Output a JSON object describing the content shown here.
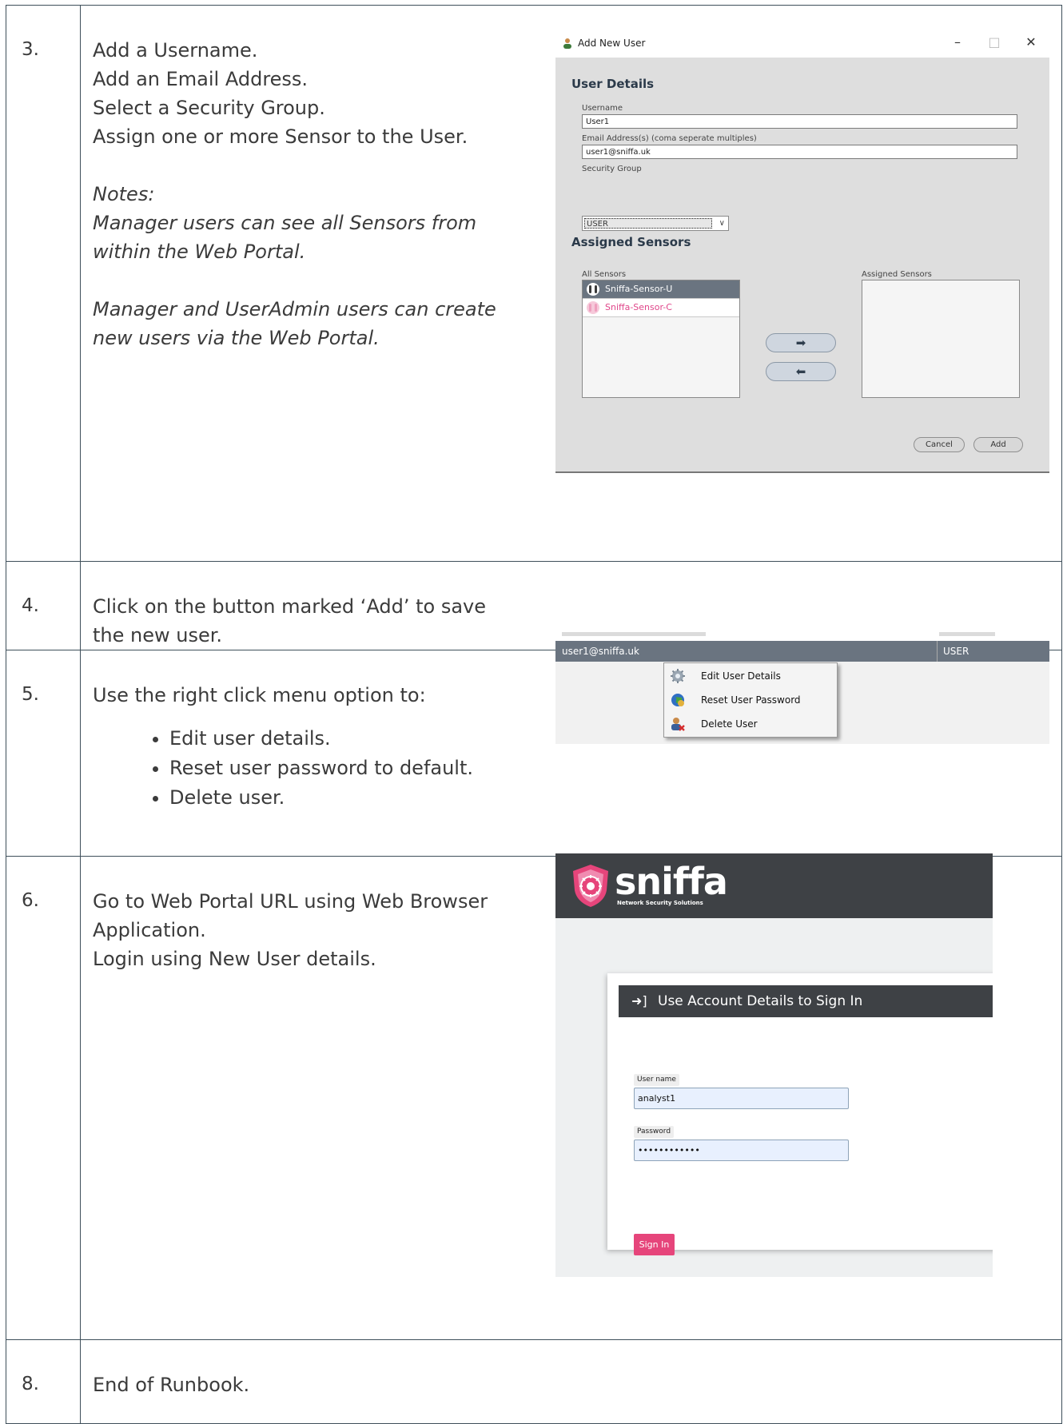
{
  "rows": [
    {
      "num": "3.",
      "lines": [
        "Add a Username.",
        "Add an Email Address.",
        "Select a Security Group.",
        "Assign one or more Sensor to the User."
      ],
      "notes": [
        "Notes:",
        "Manager users can see all Sensors from",
        "within the Web Portal.",
        "",
        "Manager and UserAdmin users can create",
        "new users via the Web Portal."
      ]
    },
    {
      "num": "4.",
      "lines": [
        "Click on the button marked ‘Add’ to save",
        "the new user."
      ]
    },
    {
      "num": "5.",
      "lines": [
        "Use the right click menu option to:"
      ],
      "bullets": [
        "Edit user details.",
        "Reset user password to default.",
        "Delete user."
      ]
    },
    {
      "num": "6.",
      "lines": [
        "Go to Web Portal URL using Web Browser",
        "Application.",
        "Login using New User details."
      ]
    },
    {
      "num": "8.",
      "lines": [
        "End of Runbook."
      ]
    }
  ],
  "dialog": {
    "title": "Add New User",
    "window_buttons": [
      "–",
      "□",
      "✕"
    ],
    "user_details_heading": "User Details",
    "username_label": "Username",
    "username_value": "User1",
    "email_label": "Email Address(s) (coma seperate multiples)",
    "email_value": "user1@sniffa.uk",
    "security_group_label": "Security Group",
    "security_group_value": "USER",
    "assigned_heading": "Assigned Sensors",
    "all_sensors_label": "All Sensors",
    "assigned_sensors_label": "Assigned Sensors",
    "sensors": [
      "Sniffa-Sensor-U",
      "Sniffa-Sensor-C"
    ],
    "move_right": "➡",
    "move_left": "⬅",
    "cancel": "Cancel",
    "add": "Add"
  },
  "context": {
    "row_email": "user1@sniffa.uk",
    "row_group": "USER",
    "menu": [
      "Edit User Details",
      "Reset User Password",
      "Delete User"
    ]
  },
  "portal": {
    "brand": "sniffa",
    "tagline": "Network Security Solutions",
    "card_title": "Use Account Details to Sign In",
    "username_label": "User name",
    "username_value": "analyst1",
    "password_label": "Password",
    "password_value": "••••••••••••",
    "sign_in": "Sign In",
    "accent": "#e6457b",
    "header_color": "#3e4145"
  }
}
